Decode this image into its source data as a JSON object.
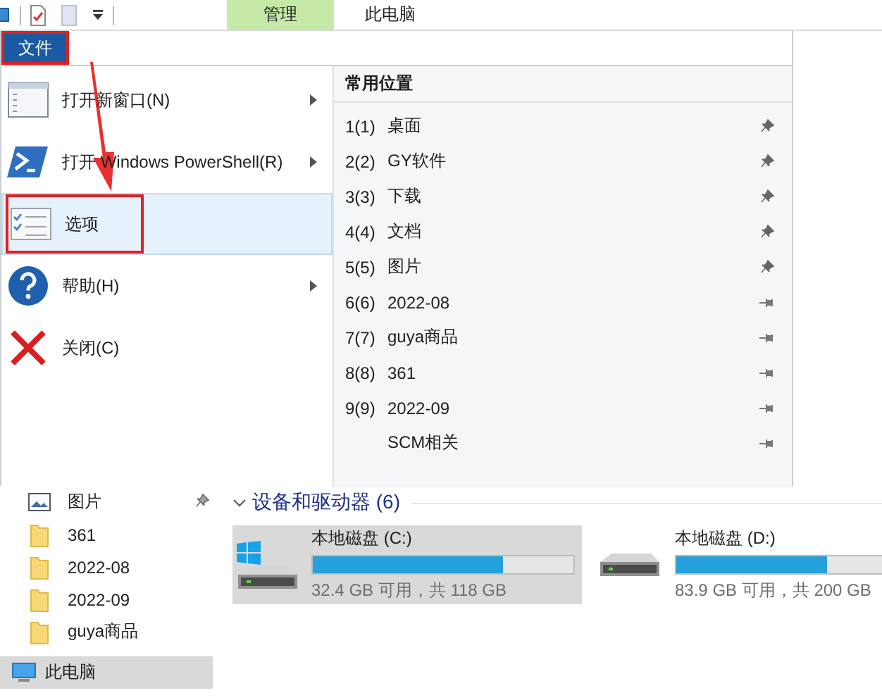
{
  "quick_access_toolbar": {
    "tabs": [
      {
        "label": "管理",
        "selected": true
      },
      {
        "label": "此电脑",
        "selected": false
      }
    ]
  },
  "file_button": {
    "label": "文件",
    "outlined": true
  },
  "file_menu": {
    "items": [
      {
        "kind": "new-window",
        "label": "打开新窗口(N)",
        "has_submenu": true,
        "selected": false,
        "outlined": false
      },
      {
        "kind": "powershell",
        "label": "打开 Windows PowerShell(R)",
        "has_submenu": true,
        "selected": false,
        "outlined": false
      },
      {
        "kind": "options",
        "label": "选项",
        "has_submenu": false,
        "selected": true,
        "outlined": true
      },
      {
        "kind": "help",
        "label": "帮助(H)",
        "has_submenu": true,
        "selected": false,
        "outlined": false
      },
      {
        "kind": "close",
        "label": "关闭(C)",
        "has_submenu": false,
        "selected": false,
        "outlined": false
      }
    ],
    "frequent_places": {
      "title": "常用位置",
      "items": [
        {
          "number": "1(1)",
          "name": "桌面",
          "pinned": true
        },
        {
          "number": "2(2)",
          "name": "GY软件",
          "pinned": true
        },
        {
          "number": "3(3)",
          "name": "下载",
          "pinned": true
        },
        {
          "number": "4(4)",
          "name": "文档",
          "pinned": true
        },
        {
          "number": "5(5)",
          "name": "图片",
          "pinned": true
        },
        {
          "number": "6(6)",
          "name": "2022-08",
          "pinned": false
        },
        {
          "number": "7(7)",
          "name": "guya商品",
          "pinned": false
        },
        {
          "number": "8(8)",
          "name": "361",
          "pinned": false
        },
        {
          "number": "9(9)",
          "name": "2022-09",
          "pinned": false
        },
        {
          "name": "SCM相关",
          "pinned": false
        }
      ]
    }
  },
  "navigation_pane": {
    "items": [
      {
        "kind": "pictures",
        "label": "图片",
        "pinned": true,
        "selected": false
      },
      {
        "kind": "folder",
        "label": "361",
        "pinned": false,
        "selected": false
      },
      {
        "kind": "folder",
        "label": "2022-08",
        "pinned": false,
        "selected": false
      },
      {
        "kind": "folder",
        "label": "2022-09",
        "pinned": false,
        "selected": false
      },
      {
        "kind": "folder",
        "label": "guya商品",
        "pinned": false,
        "selected": false
      },
      {
        "kind": "computer",
        "label": "此电脑",
        "pinned": false,
        "selected": true
      }
    ]
  },
  "devices_section": {
    "title": "设备和驱动器 (6)",
    "expanded": true,
    "drives": [
      {
        "name": "本地磁盘 (C:)",
        "system": true,
        "selected": true,
        "level": 0.73,
        "space": "32.4 GB 可用，共 118 GB"
      },
      {
        "name": "本地磁盘 (D:)",
        "system": false,
        "selected": false,
        "level": 0.58,
        "space": "83.9 GB 可用，共 200 GB"
      }
    ]
  }
}
